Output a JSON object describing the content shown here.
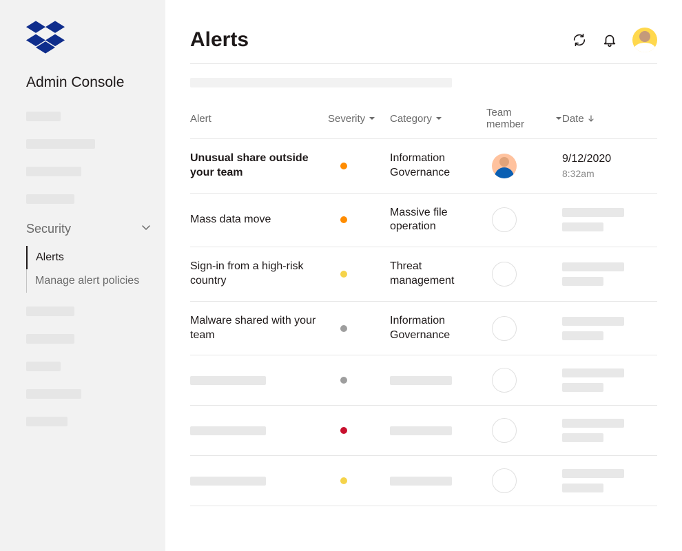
{
  "sidebar": {
    "title": "Admin Console",
    "security_label": "Security",
    "subnav": {
      "alerts": "Alerts",
      "manage": "Manage alert policies"
    }
  },
  "header": {
    "title": "Alerts"
  },
  "columns": {
    "alert": "Alert",
    "severity": "Severity",
    "category": "Category",
    "member": "Team member",
    "date": "Date"
  },
  "severity_colors": {
    "orange": "#ff8c00",
    "yellow": "#f5d34a",
    "grey": "#9e9e9e",
    "red": "#c8102e"
  },
  "alerts": [
    {
      "name": "Unusual share outside your team",
      "bold": true,
      "severity": "orange",
      "category": "Information Governance",
      "member": "avatar",
      "date": "9/12/2020",
      "time": "8:32am"
    },
    {
      "name": "Mass data move",
      "bold": false,
      "severity": "orange",
      "category": "Massive file operation",
      "member": "placeholder",
      "date": "",
      "time": ""
    },
    {
      "name": "Sign-in from a high-risk country",
      "bold": false,
      "severity": "yellow",
      "category": "Threat management",
      "member": "placeholder",
      "date": "",
      "time": ""
    },
    {
      "name": "Malware shared with your team",
      "bold": false,
      "severity": "grey",
      "category": "Information Governance",
      "member": "placeholder",
      "date": "",
      "time": ""
    },
    {
      "name": "",
      "bold": false,
      "severity": "grey",
      "category": "",
      "member": "placeholder",
      "date": "",
      "time": ""
    },
    {
      "name": "",
      "bold": false,
      "severity": "red",
      "category": "",
      "member": "placeholder",
      "date": "",
      "time": ""
    },
    {
      "name": "",
      "bold": false,
      "severity": "yellow",
      "category": "",
      "member": "placeholder",
      "date": "",
      "time": ""
    }
  ]
}
